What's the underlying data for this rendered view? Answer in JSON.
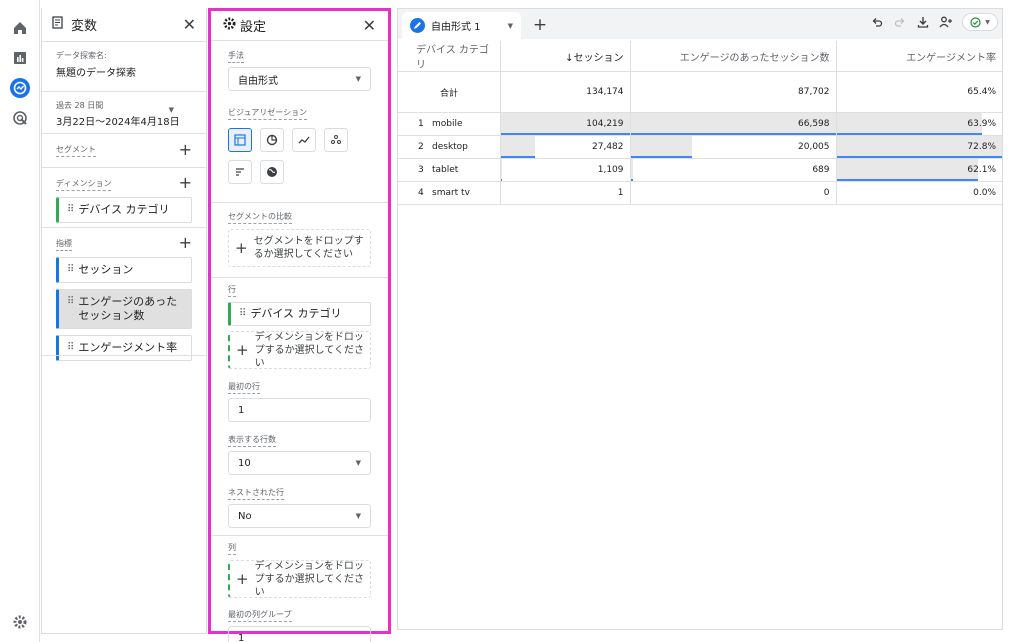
{
  "variables": {
    "title": "変数",
    "exploration_name_label": "データ探索名:",
    "exploration_name": "無題のデータ探索",
    "date_label": "過去 28 日間",
    "date_range": "3月22日〜2024年4月18日",
    "segments_label": "セグメント",
    "dimensions_label": "ディメンション",
    "dimensions": [
      "デバイス カテゴリ"
    ],
    "metrics_label": "指標",
    "metrics": [
      "セッション",
      "エンゲージのあったセッション数",
      "エンゲージメント率"
    ]
  },
  "settings": {
    "title": "設定",
    "technique_label": "手法",
    "technique": "自由形式",
    "visualization_label": "ビジュアリゼーション",
    "segment_compare_label": "セグメントの比較",
    "segment_drop": "セグメントをドロップするか選択してください",
    "rows_label": "行",
    "row_dimension": "デバイス カテゴリ",
    "dimension_drop": "ディメンションをドロップするか選択してください",
    "first_row_label": "最初の行",
    "first_row": "1",
    "rows_shown_label": "表示する行数",
    "rows_shown": "10",
    "nested_label": "ネストされた行",
    "nested": "No",
    "columns_label": "列",
    "column_drop": "ディメンションをドロップするか選択してください",
    "first_col_group_label": "最初の列グループ",
    "first_col_group": "1"
  },
  "tab": {
    "label": "自由形式 1"
  },
  "table": {
    "headers": [
      "デバイス カテゴリ",
      "↓セッション",
      "エンゲージのあったセッション数",
      "エンゲージメント率"
    ],
    "total": {
      "label": "合計",
      "sessions": "134,174",
      "engaged": "87,702",
      "rate": "65.4%"
    },
    "rows": [
      {
        "n": "1",
        "device": "mobile",
        "sessions": "104,219",
        "engaged": "66,598",
        "rate": "63.9%",
        "s_frac": 1.0,
        "e_frac": 1.0,
        "r_frac": 0.878
      },
      {
        "n": "2",
        "device": "desktop",
        "sessions": "27,482",
        "engaged": "20,005",
        "rate": "72.8%",
        "s_frac": 0.264,
        "e_frac": 0.3,
        "r_frac": 1.0
      },
      {
        "n": "3",
        "device": "tablet",
        "sessions": "1,109",
        "engaged": "689",
        "rate": "62.1%",
        "s_frac": 0.011,
        "e_frac": 0.01,
        "r_frac": 0.853
      },
      {
        "n": "4",
        "device": "smart tv",
        "sessions": "1",
        "engaged": "0",
        "rate": "0.0%",
        "s_frac": 0,
        "e_frac": 0,
        "r_frac": 0
      }
    ]
  },
  "colors": {
    "accent": "#1a73e8",
    "highlight_border": "#ea2fc8",
    "dimension": "#34a853"
  }
}
